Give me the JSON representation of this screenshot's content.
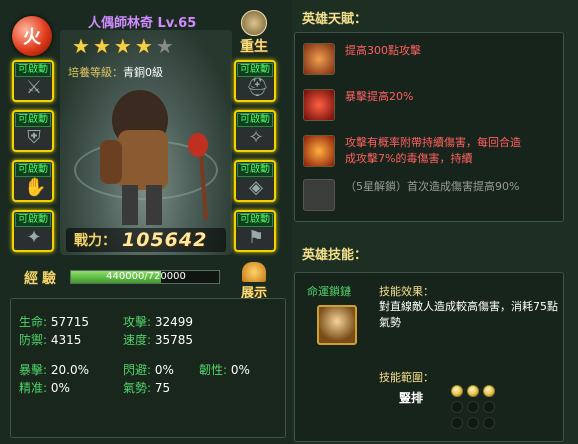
{
  "hero": {
    "element_glyph": "火",
    "name": "人偶師林奇 Lv.65",
    "stars_filled": 4,
    "stars_total": 5,
    "rebirth_label": "重生",
    "cultivation_label": "培養等級：",
    "cultivation_value": "青銅0級",
    "power_label": "戰力：",
    "power_value": "105642",
    "show_label": "展示"
  },
  "equipment_slots": {
    "tag": "可啟動",
    "left": [
      "gear-icon",
      "gear-icon",
      "gear-icon",
      "gear-icon"
    ],
    "right": [
      "gear-icon",
      "gear-icon",
      "gear-icon",
      "gear-icon"
    ]
  },
  "experience": {
    "label": "經驗",
    "current": 440000,
    "max": 720000,
    "text": "440000/720000",
    "fraction": 0.611
  },
  "stats": {
    "hp_k": "生命:",
    "hp_v": "57715",
    "atk_k": "攻擊:",
    "atk_v": "32499",
    "def_k": "防禦:",
    "def_v": "4315",
    "spd_k": "速度:",
    "spd_v": "35785",
    "crit_k": "暴擊:",
    "crit_v": "20.0%",
    "dodge_k": "閃避:",
    "dodge_v": "0%",
    "tough_k": "韌性:",
    "tough_v": "0%",
    "acc_k": "精准:",
    "acc_v": "0%",
    "qi_k": "氣勢:",
    "qi_v": "75"
  },
  "talents": {
    "title": "英雄天賦：",
    "items": [
      {
        "text": "提高300點攻擊",
        "state": "active",
        "icon": "fist-icon"
      },
      {
        "text": "暴擊提高20%",
        "state": "active",
        "icon": "critical-icon"
      },
      {
        "text": "攻擊有概率附帶持續傷害，每回合造成攻擊7%的毒傷害，持續",
        "state": "active",
        "icon": "poison-icon"
      },
      {
        "text": "（5星解鎖）首次造成傷害提高90%",
        "state": "locked",
        "icon": "locked-talent-icon"
      }
    ]
  },
  "skill": {
    "title": "英雄技能：",
    "name": "命運鎖鏈",
    "effect_label": "技能效果：",
    "effect_text": "對直線敵人造成較高傷害，消耗75點氣勢",
    "range_label": "技能範圍：",
    "range_value": "豎排",
    "range_grid": [
      1,
      1,
      1,
      0,
      0,
      0,
      0,
      0,
      0
    ]
  },
  "colors": {
    "panel_bg": "#1d2e22",
    "accent_gold": "#f4d200",
    "green_text": "#50d46a",
    "talent_red": "#ff6060",
    "name_purple": "#d08cff"
  }
}
